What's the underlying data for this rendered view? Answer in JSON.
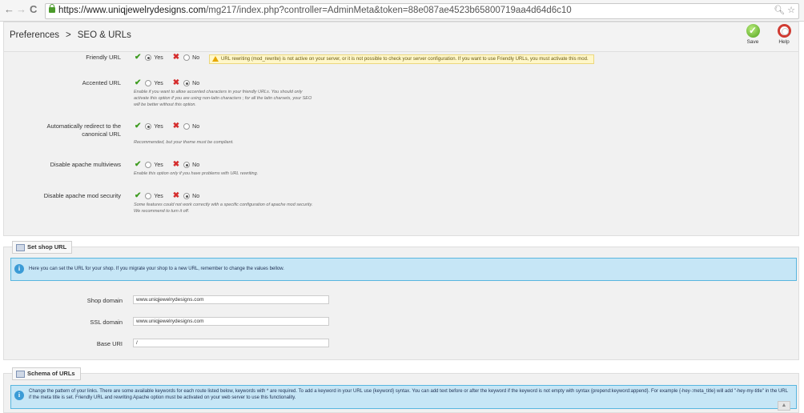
{
  "browser": {
    "url_host": "https://www.uniqjewelrydesigns.com",
    "url_path": "/mg217/index.php?controller=AdminMeta&token=88e087ae4523b65800719aa4d64d6c10"
  },
  "header": {
    "breadcrumb_root": "Preferences",
    "breadcrumb_sep": ">",
    "breadcrumb_current": "SEO & URLs",
    "save_label": "Save",
    "help_label": "Help"
  },
  "settings": {
    "yes": "Yes",
    "no": "No",
    "friendly_url": {
      "label": "Friendly URL",
      "selected": "yes",
      "warning": "URL rewriting (mod_rewrite) is not active on your server, or it is not possible to check your server configuration. If you want to use Friendly URLs, you must activate this mod."
    },
    "accented_url": {
      "label": "Accented URL",
      "selected": "no",
      "hint_1": "Enable if you want to allow accented characters in your friendly URLs. You should only",
      "hint_2": "activate this option if you are using non-latin characters ; for all the latin charsets, your SEO",
      "hint_3": "will be better without this option."
    },
    "redirect_canonical": {
      "label_1": "Automatically redirect to the",
      "label_2": "canonical URL",
      "selected": "yes",
      "hint": "Recommended, but your theme must be compliant."
    },
    "disable_multiviews": {
      "label": "Disable apache multiviews",
      "selected": "no",
      "hint": "Enable this option only if you have problems with URL rewriting."
    },
    "disable_mod_security": {
      "label": "Disable apache mod security",
      "selected": "no",
      "hint_1": "Some features could not work correctly with a specific configuration of apache mod security.",
      "hint_2": "We recommend to turn it off."
    }
  },
  "shop_url": {
    "legend": "Set shop URL",
    "info": "Here you can set the URL for your shop. If you migrate your shop to a new URL, remember to change the values bellow.",
    "shop_domain_label": "Shop domain",
    "shop_domain_value": "www.uniqjewelrydesigns.com",
    "ssl_domain_label": "SSL domain",
    "ssl_domain_value": "www.uniqjewelrydesigns.com",
    "base_uri_label": "Base URI",
    "base_uri_value": "/"
  },
  "schema": {
    "legend": "Schema of URLs",
    "info": "Change the pattern of your links. There are some available keywords for each route listed below, keywords with * are required. To add a keyword in your URL use {keyword} syntax. You can add text before or after the keyword if the keyword is not empty with syntax {prepend:keyword:append}. For example {-hey-:meta_title} will add \"-hey-my-title\" in the URL if the meta title is set. Friendly URL and rewriting Apache option must be activated on your web server to use this functionality."
  }
}
